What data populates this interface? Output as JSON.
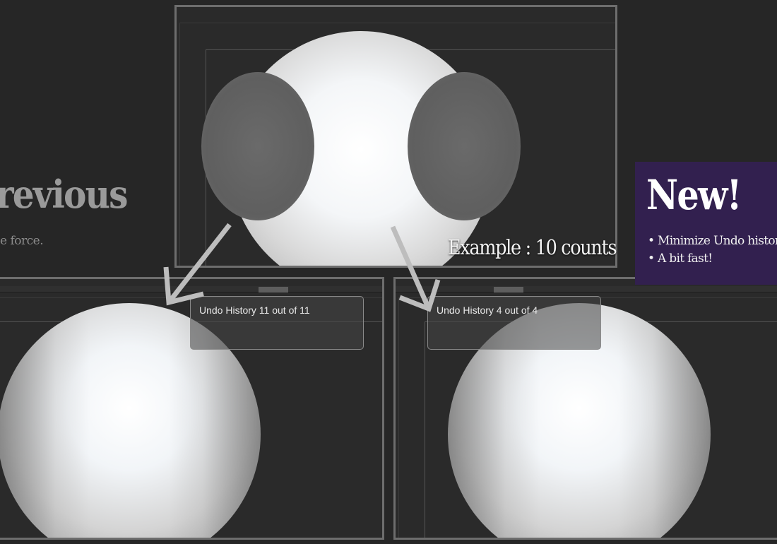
{
  "left_heading": {
    "title": "revious",
    "subtitle": "e force."
  },
  "top_viewport": {
    "example_label": "Example : 10 counts"
  },
  "bottom_left_viewport": {
    "undo_text": "Undo History 11 out of 11"
  },
  "bottom_right_viewport": {
    "undo_text": "Undo History 4 out of 4"
  },
  "new_box": {
    "title": "New!",
    "items": [
      "• Minimize Undo history p",
      "• A bit fast!"
    ]
  },
  "colors": {
    "background": "#262626",
    "panel_border": "#6d6d6d",
    "new_box_bg": "#32204f",
    "arrow": "#bdbdbd"
  }
}
